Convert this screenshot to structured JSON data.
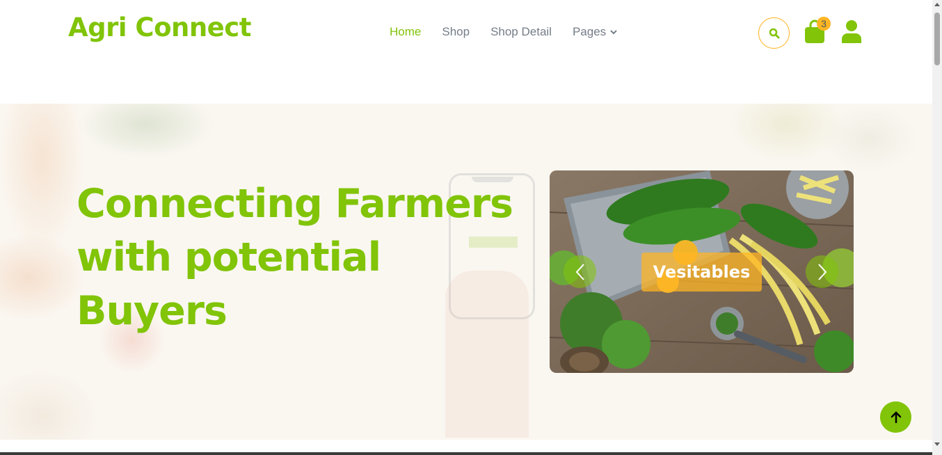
{
  "header": {
    "brand": "Agri Connect",
    "nav": [
      {
        "label": "Home",
        "active": true
      },
      {
        "label": "Shop",
        "active": false
      },
      {
        "label": "Shop Detail",
        "active": false
      },
      {
        "label": "Pages",
        "active": false,
        "dropdown": true
      }
    ],
    "cart_count": "3",
    "icons": [
      "search-icon",
      "shopping-bag-icon",
      "user-icon"
    ]
  },
  "hero": {
    "headline": "Connecting Farmers with potential Buyers",
    "carousel": {
      "slide_label": "Vesitables",
      "prev_icon": "chevron-left-icon",
      "next_icon": "chevron-right-icon"
    }
  },
  "back_to_top_icon": "arrow-up-icon",
  "colors": {
    "primary": "#81c408",
    "secondary": "#ffb524",
    "nav_text": "#747d88",
    "hero_bg": "#faf7f1"
  }
}
